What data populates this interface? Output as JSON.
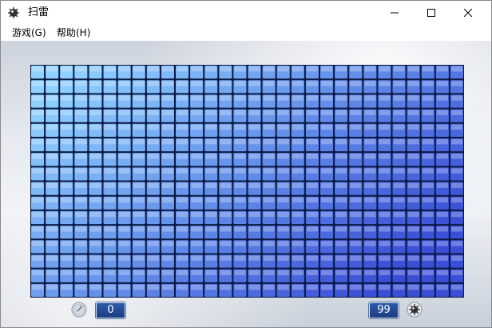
{
  "window": {
    "title": "扫雷",
    "controls": {
      "minimize": "—",
      "maximize": "☐",
      "close": "✕"
    }
  },
  "menu": {
    "items": [
      "游戏(G)",
      "帮助(H)"
    ]
  },
  "board": {
    "columns": 30,
    "rows": 16,
    "state": "unrevealed",
    "tile_color_light": "#8fd2ff",
    "tile_color_dark": "#3a4fd6",
    "border_color": "#0b1a44"
  },
  "status": {
    "timer_icon": "clock-icon",
    "timer_value": "0",
    "mines_icon": "mine-icon",
    "mines_remaining": "99"
  }
}
